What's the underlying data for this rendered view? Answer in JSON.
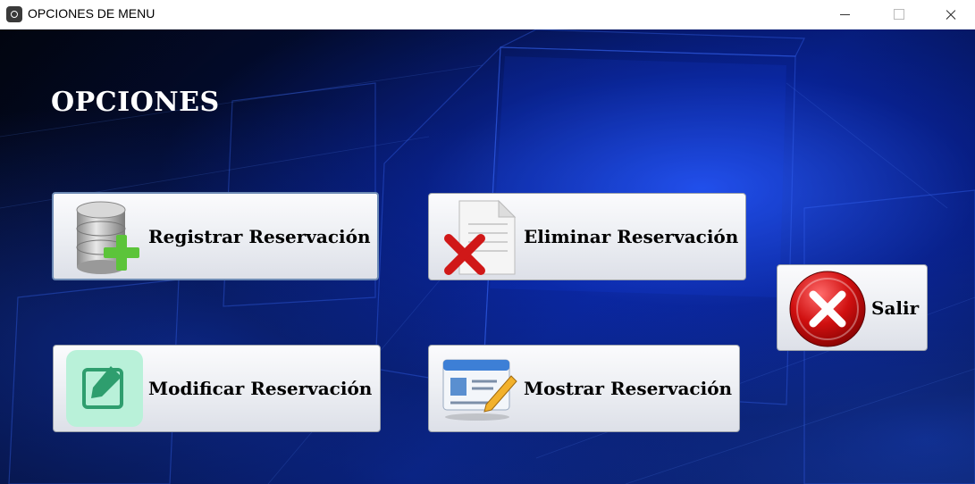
{
  "window": {
    "title": "OPCIONES DE MENU",
    "icon": "app-icon"
  },
  "main": {
    "title": "OPCIONES",
    "buttons": [
      {
        "label": "Registrar Reservación",
        "icon": "database-add-icon"
      },
      {
        "label": "Eliminar Reservación",
        "icon": "document-delete-icon"
      },
      {
        "label": "Modificar Reservación",
        "icon": "edit-icon"
      },
      {
        "label": "Mostrar Reservación",
        "icon": "id-card-edit-icon"
      },
      {
        "label": "Salir",
        "icon": "exit-x-icon"
      }
    ]
  },
  "colors": {
    "background": "#04103a",
    "accent_blue": "#2a5aff",
    "exit_red": "#d01010",
    "add_green": "#5cc43a"
  }
}
